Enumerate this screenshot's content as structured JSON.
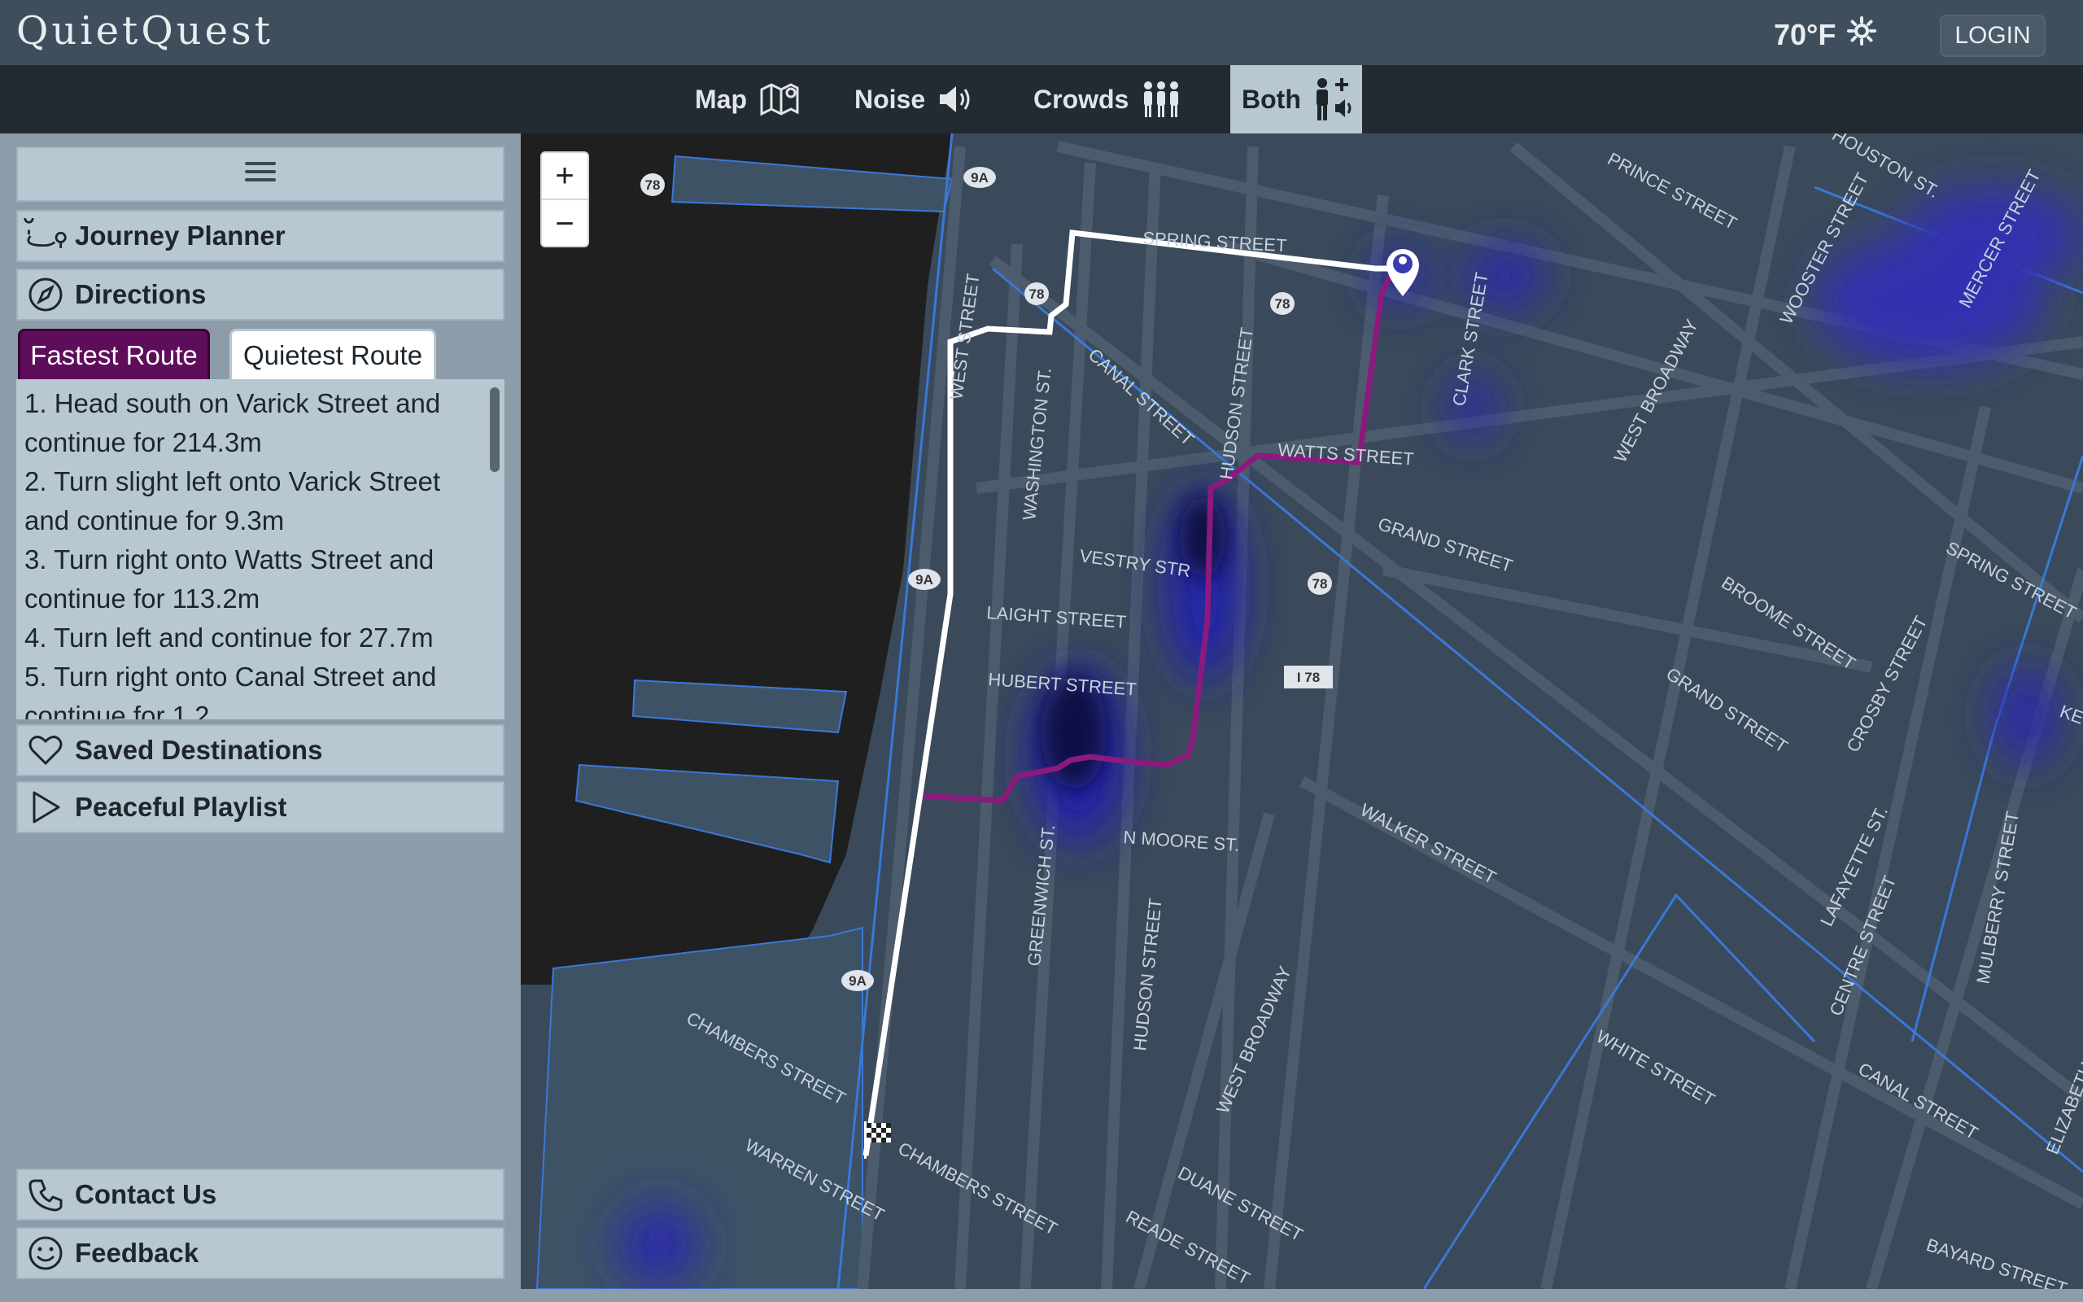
{
  "header": {
    "logo": "QuietQuest",
    "temperature": "70°F",
    "login_label": "LOGIN",
    "weather_icon": "sun-icon"
  },
  "nav": {
    "tabs": [
      {
        "label": "Map",
        "icon": "map-icon"
      },
      {
        "label": "Noise",
        "icon": "speaker-icon"
      },
      {
        "label": "Crowds",
        "icon": "people-icon"
      },
      {
        "label": "Both",
        "icon": "person-noise-icon",
        "active": true
      }
    ]
  },
  "sidebar": {
    "menu_icon": "hamburger-icon",
    "journey_planner": "Journey Planner",
    "directions": "Directions",
    "route_tabs": {
      "fastest": "Fastest Route",
      "quietest": "Quietest Route",
      "selected": "fastest"
    },
    "steps": [
      "1. Head south on Varick Street and continue for 214.3m",
      "2. Turn slight left onto Varick Street and continue for 9.3m",
      "3. Turn right onto Watts Street and continue for 113.2m",
      "4. Turn left and continue for 27.7m",
      "5. Turn right onto Canal Street and continue for 1.2..."
    ],
    "saved_destinations": "Saved Destinations",
    "peaceful_playlist": "Peaceful Playlist",
    "contact_us": "Contact Us",
    "feedback": "Feedback"
  },
  "map": {
    "zoom_in": "+",
    "zoom_out": "−",
    "colors": {
      "fastest_route": "#8a1a7e",
      "quietest_route": "#ffffff",
      "heat": "#1a1a9a",
      "water": "#1f1f1f",
      "land": "#3a4a5a"
    },
    "street_labels": [
      "SPRING STREET",
      "PRINCE STREET",
      "HOUSTON ST.",
      "WOOSTER STREET",
      "MERCER STREET",
      "WEST BROADWAY",
      "CLARK STREET",
      "WATTS STREET",
      "GRAND STREET",
      "SPRING STREET",
      "BROOME STREET",
      "GRAND STREET",
      "CROSBY STREET",
      "CANAL STREET",
      "HUDSON STREET",
      "WASHINGTON ST.",
      "WEST STREET",
      "VESTRY STR",
      "LAIGHT STREET",
      "HUBERT STREET",
      "N MOORE ST.",
      "WALKER STREET",
      "LAFAYETTE ST.",
      "CENTRE STREET",
      "MULBERRY STREET",
      "WHITE STREET",
      "CANAL STREET",
      "GREENWICH ST.",
      "HUDSON STREET",
      "WEST BROADWAY",
      "CHAMBERS STREET",
      "WARREN STREET",
      "CHAMBERS STREET",
      "DUANE STREET",
      "READE STREET",
      "BAYARD STREET",
      "ELIZABETH",
      "KE"
    ],
    "shields": [
      "78",
      "9A",
      "78",
      "78",
      "9A",
      "78",
      "I 78",
      "9A"
    ]
  }
}
